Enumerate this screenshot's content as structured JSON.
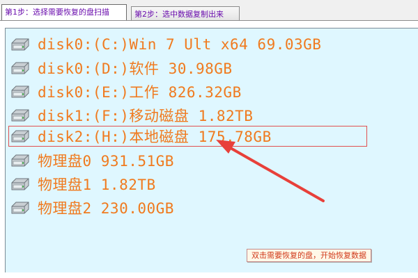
{
  "tabs": [
    {
      "label": "第1步：选择需要恢复的盘扫描",
      "active": true
    },
    {
      "label": "第2步：选中数据复制出来",
      "active": false
    }
  ],
  "disks": [
    {
      "label": "disk0:(C:)Win 7 Ult x64 69.03GB",
      "icon": "hard-drive-icon"
    },
    {
      "label": "disk0:(D:)软件 30.98GB",
      "icon": "hard-drive-icon"
    },
    {
      "label": "disk0:(E:)工作 826.32GB",
      "icon": "hard-drive-icon"
    },
    {
      "label": "disk1:(F:)移动磁盘 1.82TB",
      "icon": "hard-drive-icon"
    },
    {
      "label": "disk2:(H:)本地磁盘 175.78GB",
      "icon": "hard-drive-icon"
    },
    {
      "label": "物理盘0 931.51GB",
      "icon": "hard-drive-icon"
    },
    {
      "label": "物理盘1 1.82TB",
      "icon": "hard-drive-icon"
    },
    {
      "label": "物理盘2 230.00GB",
      "icon": "hard-drive-icon"
    }
  ],
  "selected_index": 4,
  "hint": "双击需要恢复的盘，开始恢复数据",
  "colors": {
    "list_background": "#dff7ff",
    "label_text": "#f07a1e",
    "tab_text": "#6a0dad",
    "selection_border": "#e05050",
    "arrow": "#e8403a",
    "hint_text": "#d03a1a"
  }
}
